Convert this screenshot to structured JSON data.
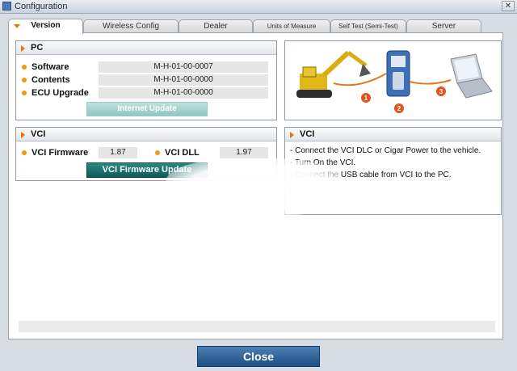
{
  "window": {
    "title": "Configuration",
    "close_glyph": "✕"
  },
  "tabs": [
    {
      "label": "Version",
      "active": true
    },
    {
      "label": "Wireless Config"
    },
    {
      "label": "Dealer"
    },
    {
      "label": "Units of Measure"
    },
    {
      "label": "Self Test (Semi-Test)"
    },
    {
      "label": "Server"
    }
  ],
  "pc": {
    "header": "PC",
    "rows": [
      {
        "label": "Software",
        "value": "M-H-01-00-0007"
      },
      {
        "label": "Contents",
        "value": "M-H-01-00-0000"
      },
      {
        "label": "ECU Upgrade",
        "value": "M-H-01-00-0000"
      }
    ],
    "internet_update_label": "Internet Update"
  },
  "diagram": {
    "steps": [
      "1",
      "2",
      "3"
    ],
    "items": [
      "excavator-icon",
      "vci-device-icon",
      "laptop-icon"
    ]
  },
  "vci": {
    "header": "VCI",
    "firmware_label": "VCI Firmware",
    "firmware_value": "1.87",
    "dll_label": "VCI DLL",
    "dll_value": "1.97",
    "firmware_update_label": "VCI Firmware Update"
  },
  "vci_info": {
    "header": "VCI",
    "lines": [
      "- Connect the VCI DLC or Cigar Power to the vehicle.",
      "- Turn On the VCI.",
      "- Connect the USB cable from VCI to the PC."
    ]
  },
  "footer": {
    "close_label": "Close"
  },
  "colors": {
    "accent_orange": "#e8760b",
    "teal": "#1a6e69",
    "close_blue": "#2b5d92"
  }
}
